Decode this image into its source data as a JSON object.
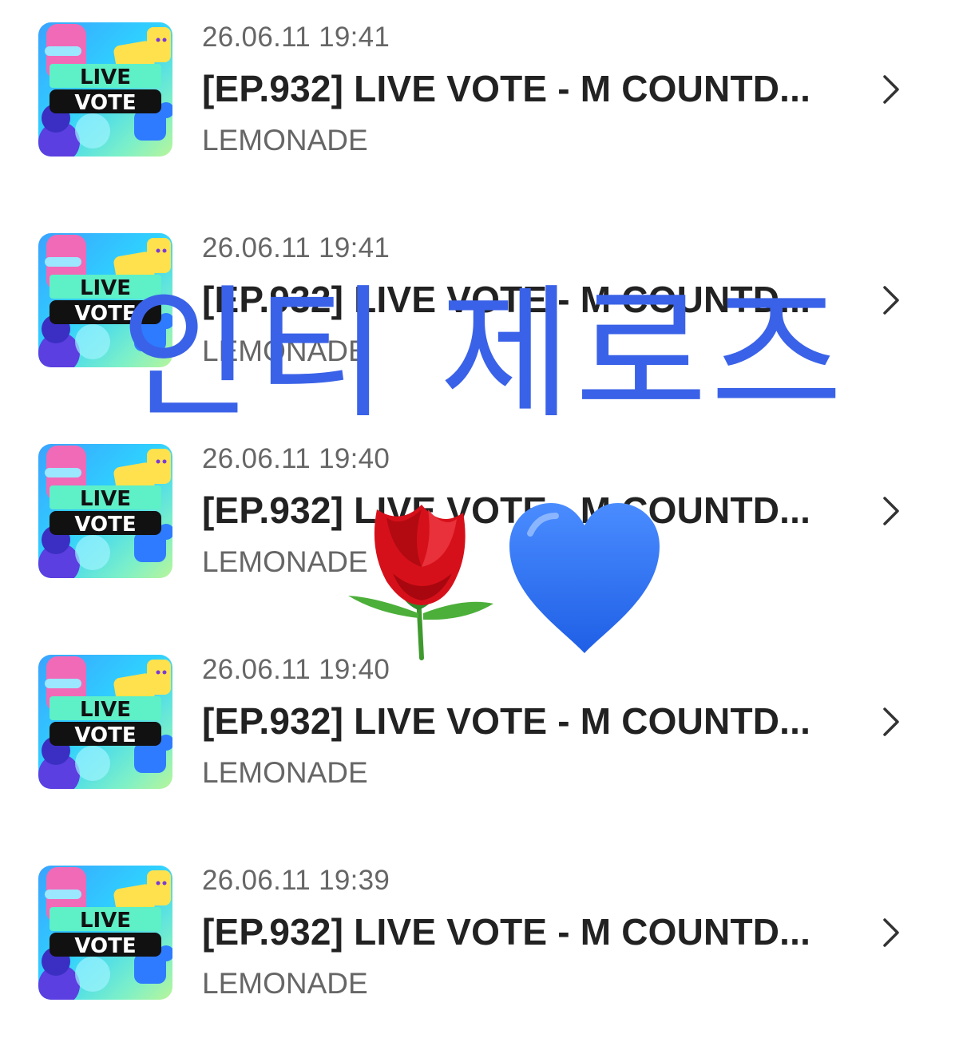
{
  "items": [
    {
      "date": "26.06.11 19:41",
      "title": "[EP.932] LIVE VOTE - M COUNTD...",
      "channel": "LEMONADE",
      "thumb_text_1": "LIVE",
      "thumb_text_2": "VOTE"
    },
    {
      "date": "26.06.11 19:41",
      "title": "[EP.932] LIVE VOTE - M COUNTD...",
      "channel": "LEMONADE",
      "thumb_text_1": "LIVE",
      "thumb_text_2": "VOTE"
    },
    {
      "date": "26.06.11 19:40",
      "title": "[EP.932] LIVE VOTE - M COUNTD...",
      "channel": "LEMONADE",
      "thumb_text_1": "LIVE",
      "thumb_text_2": "VOTE"
    },
    {
      "date": "26.06.11 19:40",
      "title": "[EP.932] LIVE VOTE - M COUNTD...",
      "channel": "LEMONADE",
      "thumb_text_1": "LIVE",
      "thumb_text_2": "VOTE"
    },
    {
      "date": "26.06.11 19:39",
      "title": "[EP.932] LIVE VOTE - M COUNTD...",
      "channel": "LEMONADE",
      "thumb_text_1": "LIVE",
      "thumb_text_2": "VOTE"
    }
  ],
  "overlay": {
    "text": "인티 제로즈",
    "color": "#3a62e8"
  },
  "stickers": {
    "rose": "rose-emoji",
    "heart": "blue-heart-emoji"
  }
}
